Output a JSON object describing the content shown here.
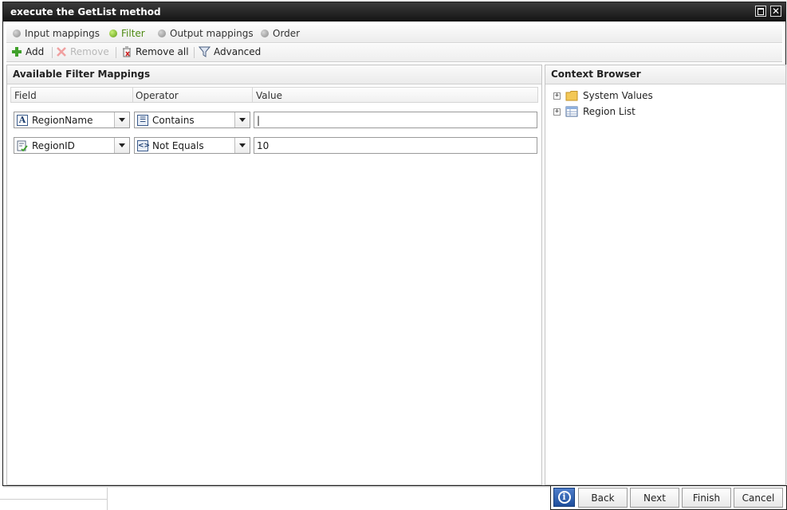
{
  "window": {
    "title": "execute the GetList method"
  },
  "tabs": [
    {
      "label": "Input mappings",
      "active": false
    },
    {
      "label": "Filter",
      "active": true
    },
    {
      "label": "Output mappings",
      "active": false
    },
    {
      "label": "Order",
      "active": false
    }
  ],
  "toolbar": {
    "add_label": "Add",
    "remove_label": "Remove",
    "remove_all_label": "Remove all",
    "advanced_label": "Advanced"
  },
  "filter_panel": {
    "title": "Available Filter Mappings",
    "columns": [
      "Field",
      "Operator",
      "Value"
    ],
    "rows": [
      {
        "field": "RegionName",
        "field_icon": "text-field-icon",
        "operator": "Contains",
        "operator_icon": "contains-operator-icon",
        "value": "|"
      },
      {
        "field": "RegionID",
        "field_icon": "key-field-icon",
        "operator": "Not Equals",
        "operator_icon": "not-equals-operator-icon",
        "value": "10"
      }
    ]
  },
  "context_browser": {
    "title": "Context Browser",
    "items": [
      {
        "label": "System Values",
        "icon": "folder-icon"
      },
      {
        "label": "Region List",
        "icon": "table-icon"
      }
    ]
  },
  "footer": {
    "back_label": "Back",
    "next_label": "Next",
    "finish_label": "Finish",
    "cancel_label": "Cancel"
  },
  "colors": {
    "title_bar": "#1a1a1a",
    "active_tab": "#4e8a12",
    "info_button": "#2f5fae"
  }
}
